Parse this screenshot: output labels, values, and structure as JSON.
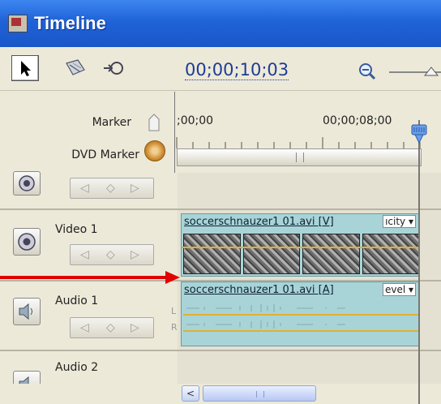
{
  "window": {
    "title": "Timeline"
  },
  "toolbar": {
    "timecode": "00;00;10;03"
  },
  "header": {
    "marker_label": "Marker",
    "dvd_marker_label": "DVD Marker",
    "ruler_start": ";00;00",
    "ruler_mid": "00;00;08;00"
  },
  "tracks": {
    "video1": {
      "name": "Video 1",
      "clip_title": "soccerschnauzer1 01.avi [V]",
      "clip_menu": "ıcity ▾"
    },
    "audio1": {
      "name": "Audio 1",
      "clip_title": "soccerschnauzer1 01.avi [A]",
      "clip_menu": "evel ▾",
      "channel_left": "L",
      "channel_right": "R"
    },
    "audio2": {
      "name": "Audio 2"
    }
  },
  "colors": {
    "title_bar": "#1f63d8",
    "clip_fill": "#a8d4d8",
    "keyframe_line": "#e0b030",
    "annotation_arrow": "#e00000",
    "timecode": "#1e3c96"
  },
  "icons": [
    "app-icon",
    "selection-tool-icon",
    "razor-tool-icon",
    "snap-tool-icon",
    "zoom-out-icon",
    "zoom-slider-thumb-icon",
    "marker-icon",
    "dvd-marker-icon",
    "eye-icon",
    "speaker-icon",
    "keyframe-prev-icon",
    "keyframe-add-icon",
    "keyframe-next-icon",
    "playhead-icon",
    "scroll-left-icon"
  ]
}
